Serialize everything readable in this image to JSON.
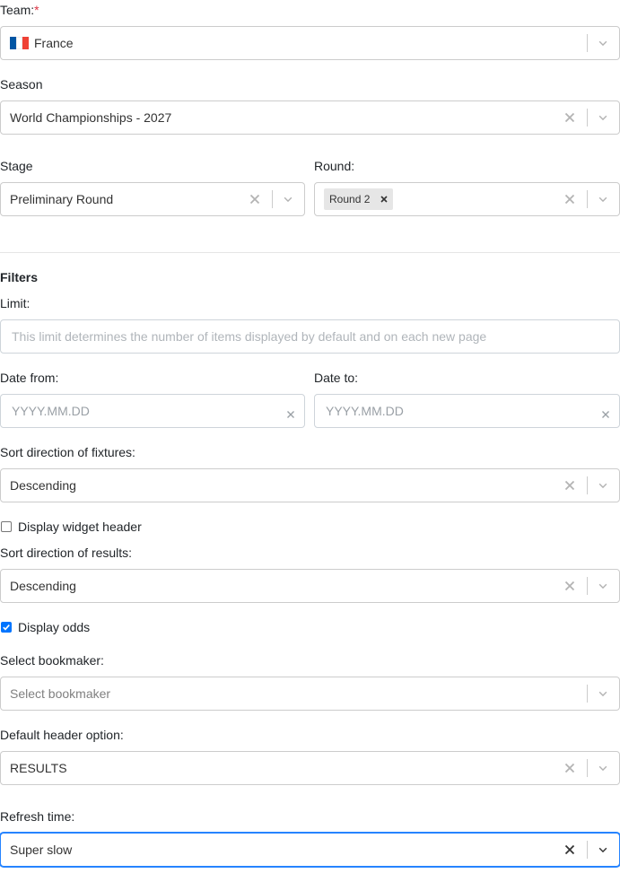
{
  "team": {
    "label": "Team:",
    "required_mark": "*",
    "value": "France",
    "flag_colors": [
      "#0055A4",
      "#FFFFFF",
      "#EF4135"
    ]
  },
  "season": {
    "label": "Season",
    "value": "World Championships - 2027"
  },
  "stage": {
    "label": "Stage",
    "value": "Preliminary Round"
  },
  "round": {
    "label": "Round:",
    "chip": "Round 2"
  },
  "filters": {
    "heading": "Filters"
  },
  "limit": {
    "label": "Limit:",
    "placeholder": "This limit determines the number of items displayed by default and on each new page"
  },
  "date_from": {
    "label": "Date from:",
    "placeholder": "YYYY.MM.DD"
  },
  "date_to": {
    "label": "Date to:",
    "placeholder": "YYYY.MM.DD"
  },
  "sort_fixtures": {
    "label": "Sort direction of fixtures:",
    "value": "Descending"
  },
  "display_widget_header": {
    "label": "Display widget header",
    "checked": false
  },
  "sort_results": {
    "label": "Sort direction of results:",
    "value": "Descending"
  },
  "display_odds": {
    "label": "Display odds",
    "checked": true
  },
  "bookmaker": {
    "label": "Select bookmaker:",
    "placeholder": "Select bookmaker"
  },
  "default_header": {
    "label": "Default header option:",
    "value": "RESULTS"
  },
  "refresh_time": {
    "label": "Refresh time:",
    "value": "Super slow"
  },
  "colors": {
    "focus_border": "#2684ff",
    "checkbox_checked": "#0075ff",
    "required": "#dc3545"
  }
}
